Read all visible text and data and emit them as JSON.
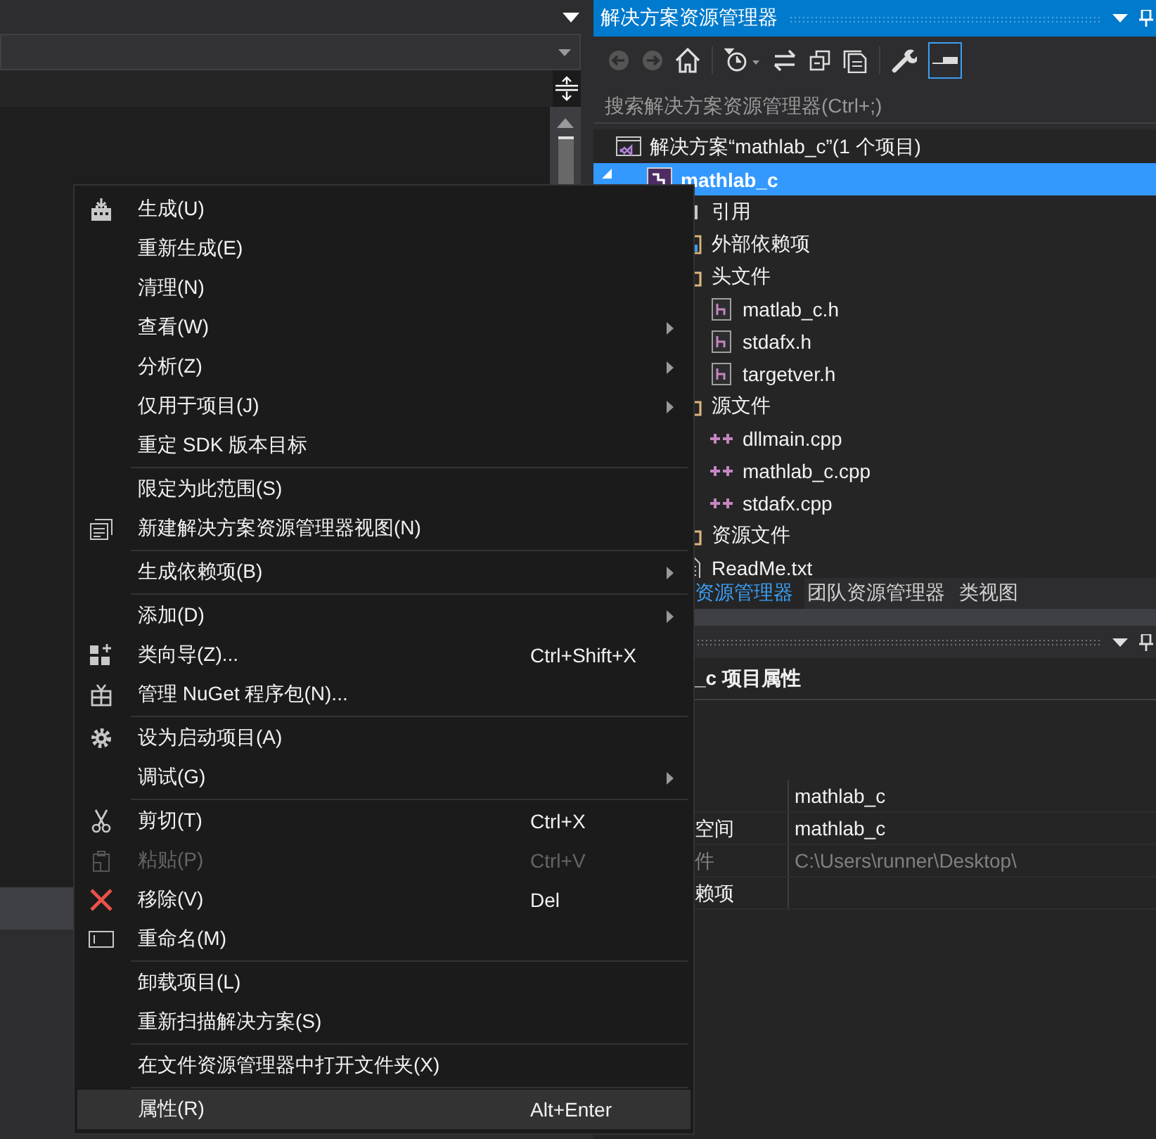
{
  "explorer": {
    "title": "解决方案资源管理器",
    "search": {
      "placeholder": "搜索解决方案资源管理器(Ctrl+;)"
    },
    "tree": [
      {
        "kind": "solution",
        "label": "解决方案“mathlab_c”(1 个项目)",
        "selected": false,
        "children": [
          {
            "kind": "project",
            "label": "mathlab_c",
            "selected": true,
            "expanded": true,
            "children": [
              {
                "kind": "references",
                "label": "引用",
                "selected": false
              },
              {
                "kind": "external",
                "label": "外部依赖项",
                "selected": false
              },
              {
                "kind": "folder",
                "label": "头文件",
                "selected": false,
                "children": [
                  {
                    "kind": "header",
                    "label": "matlab_c.h",
                    "selected": false
                  },
                  {
                    "kind": "header",
                    "label": "stdafx.h",
                    "selected": false
                  },
                  {
                    "kind": "header",
                    "label": "targetver.h",
                    "selected": false
                  }
                ]
              },
              {
                "kind": "folder",
                "label": "源文件",
                "selected": false,
                "children": [
                  {
                    "kind": "cpp",
                    "label": "dllmain.cpp",
                    "selected": false
                  },
                  {
                    "kind": "cpp",
                    "label": "mathlab_c.cpp",
                    "selected": false
                  },
                  {
                    "kind": "cpp",
                    "label": "stdafx.cpp",
                    "selected": false
                  }
                ]
              },
              {
                "kind": "folder",
                "label": "资源文件",
                "selected": false
              },
              {
                "kind": "text",
                "label": "ReadMe.txt",
                "selected": false
              }
            ]
          }
        ]
      }
    ],
    "tabs": [
      {
        "label": "资源管理器",
        "selected": true
      },
      {
        "label": "团队资源管理器",
        "selected": false
      },
      {
        "label": "类视图",
        "selected": false
      }
    ]
  },
  "properties": {
    "header": "_c 项目属性",
    "rows": [
      {
        "name": "",
        "value": "mathlab_c",
        "disabled": false
      },
      {
        "name": "空间",
        "value": "mathlab_c",
        "disabled": false
      },
      {
        "name": "件",
        "value": "C:\\Users\\runner\\Desktop\\",
        "disabled": true
      },
      {
        "name": "赖项",
        "value": "",
        "disabled": false
      }
    ]
  },
  "context_menu": [
    {
      "kind": "item",
      "label": "生成(U)",
      "disabled": false,
      "selected": false
    },
    {
      "kind": "item",
      "label": "重新生成(E)",
      "disabled": false,
      "selected": false
    },
    {
      "kind": "item",
      "label": "清理(N)",
      "disabled": false,
      "selected": false
    },
    {
      "kind": "submenu",
      "label": "查看(W)",
      "disabled": false,
      "selected": false
    },
    {
      "kind": "submenu",
      "label": "分析(Z)",
      "disabled": false,
      "selected": false
    },
    {
      "kind": "submenu",
      "label": "仅用于项目(J)",
      "disabled": false,
      "selected": false
    },
    {
      "kind": "item",
      "label": "重定 SDK 版本目标",
      "disabled": false,
      "selected": false
    },
    {
      "kind": "separator"
    },
    {
      "kind": "item",
      "label": "限定为此范围(S)",
      "disabled": false,
      "selected": false
    },
    {
      "kind": "item",
      "label": "新建解决方案资源管理器视图(N)",
      "disabled": false,
      "selected": false
    },
    {
      "kind": "separator"
    },
    {
      "kind": "submenu",
      "label": "生成依赖项(B)",
      "disabled": false,
      "selected": false
    },
    {
      "kind": "separator"
    },
    {
      "kind": "submenu",
      "label": "添加(D)",
      "disabled": false,
      "selected": false
    },
    {
      "kind": "item",
      "label": "类向导(Z)...",
      "shortcut": "Ctrl+Shift+X",
      "disabled": false,
      "selected": false
    },
    {
      "kind": "item",
      "label": "管理 NuGet 程序包(N)...",
      "disabled": false,
      "selected": false
    },
    {
      "kind": "separator"
    },
    {
      "kind": "item",
      "label": "设为启动项目(A)",
      "disabled": false,
      "selected": false
    },
    {
      "kind": "submenu",
      "label": "调试(G)",
      "disabled": false,
      "selected": false
    },
    {
      "kind": "separator"
    },
    {
      "kind": "item",
      "label": "剪切(T)",
      "shortcut": "Ctrl+X",
      "disabled": false,
      "selected": false
    },
    {
      "kind": "item",
      "label": "粘贴(P)",
      "shortcut": "Ctrl+V",
      "disabled": true,
      "selected": false
    },
    {
      "kind": "item",
      "label": "移除(V)",
      "shortcut": "Del",
      "disabled": false,
      "selected": false
    },
    {
      "kind": "item",
      "label": "重命名(M)",
      "disabled": false,
      "selected": false
    },
    {
      "kind": "separator"
    },
    {
      "kind": "item",
      "label": "卸载项目(L)",
      "disabled": false,
      "selected": false
    },
    {
      "kind": "item",
      "label": "重新扫描解决方案(S)",
      "disabled": false,
      "selected": false
    },
    {
      "kind": "separator"
    },
    {
      "kind": "item",
      "label": "在文件资源管理器中打开文件夹(X)",
      "disabled": false,
      "selected": false
    },
    {
      "kind": "separator"
    },
    {
      "kind": "item",
      "label": "属性(R)",
      "shortcut": "Alt+Enter",
      "disabled": false,
      "selected": true
    }
  ]
}
